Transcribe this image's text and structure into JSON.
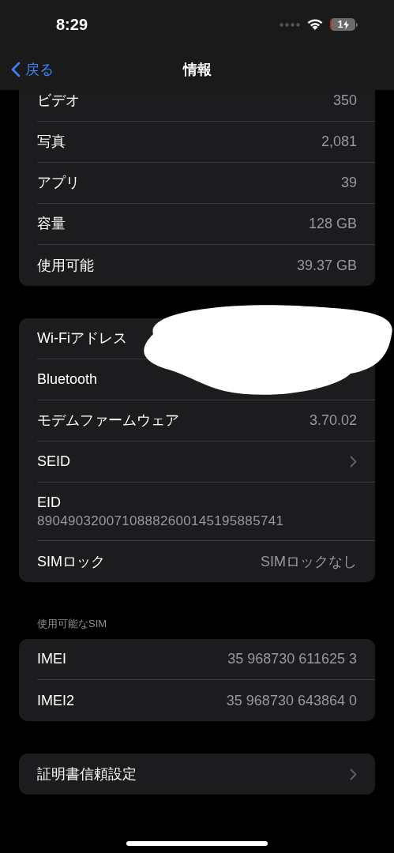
{
  "status_bar": {
    "time": "8:29",
    "battery": "1"
  },
  "nav": {
    "back": "戻る",
    "title": "情報"
  },
  "groups": [
    {
      "redacted": false,
      "rows": [
        {
          "kind": "value",
          "label": "ビデオ",
          "value": "350"
        },
        {
          "kind": "value",
          "label": "写真",
          "value": "2,081"
        },
        {
          "kind": "value",
          "label": "アプリ",
          "value": "39"
        },
        {
          "kind": "value",
          "label": "容量",
          "value": "128 GB"
        },
        {
          "kind": "value",
          "label": "使用可能",
          "value": "39.37 GB"
        }
      ]
    },
    {
      "redacted": true,
      "rows": [
        {
          "kind": "plain",
          "label": "Wi-Fiアドレス"
        },
        {
          "kind": "plain",
          "label": "Bluetooth"
        },
        {
          "kind": "value",
          "label": "モデムファームウェア",
          "value": "3.70.02"
        },
        {
          "kind": "chevron",
          "label": "SEID"
        },
        {
          "kind": "stacked",
          "label": "EID",
          "value": "89049032007108882600145195885741"
        },
        {
          "kind": "value",
          "label": "SIMロック",
          "value": "SIMロックなし"
        }
      ]
    },
    {
      "header": "使用可能なSIM",
      "redacted": false,
      "rows": [
        {
          "kind": "value",
          "label": "IMEI",
          "value": "35 968730 611625 3"
        },
        {
          "kind": "value",
          "label": "IMEI2",
          "value": "35 968730 643864 0"
        }
      ]
    },
    {
      "redacted": false,
      "rows": [
        {
          "kind": "chevron",
          "label": "証明書信頼設定"
        }
      ]
    }
  ]
}
